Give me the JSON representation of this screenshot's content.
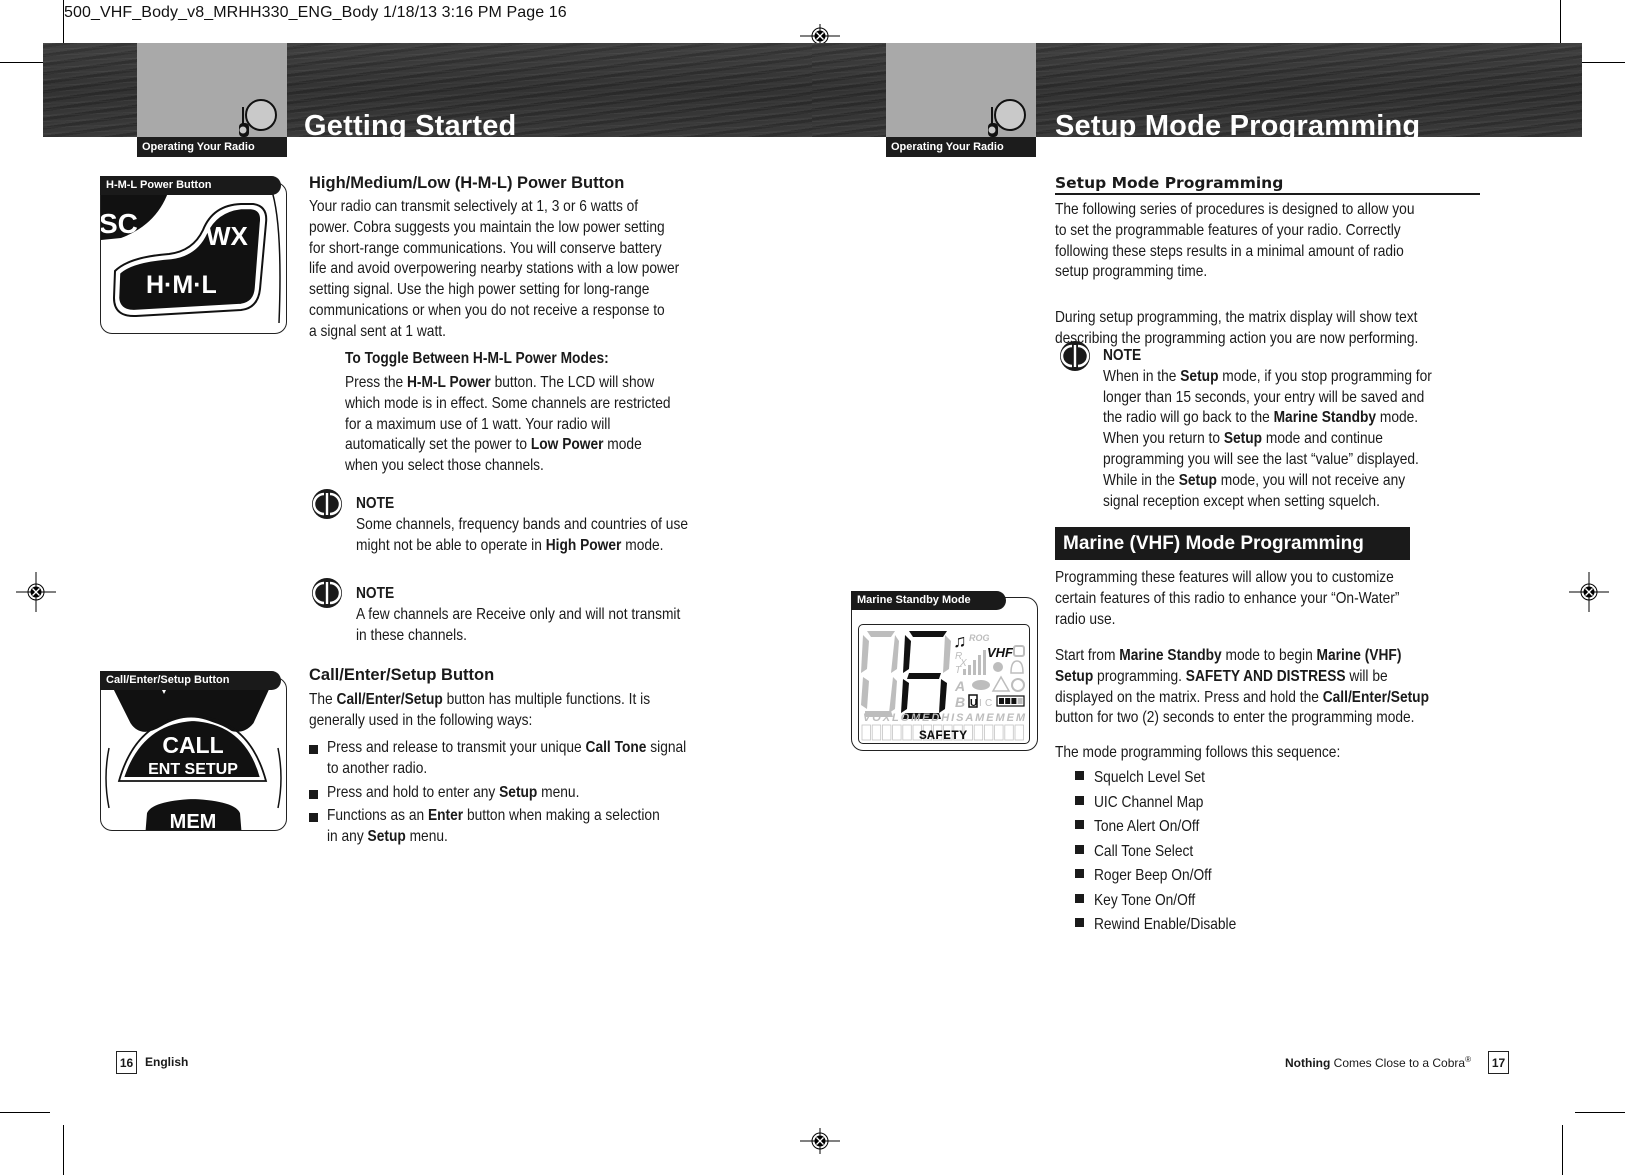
{
  "slug": "500_VHF_Body_v8_MRHH330_ENG_Body  1/18/13  3:16 PM  Page 16",
  "left_page": {
    "tab_label": "Operating Your Radio",
    "title": "Getting Started",
    "illustration_hml": {
      "tag": "H-M-L Power Button",
      "keys": [
        "SC",
        "WX",
        "H·M·L"
      ]
    },
    "hml_section": {
      "heading": "High/Medium/Low (H-M-L) Power Button",
      "body_lines": [
        "Your radio can transmit selectively at 1, 3 or 6 watts of",
        "power. Cobra suggests you maintain the low power setting",
        "for short-range communications. You will conserve battery",
        "life and avoid overpowering nearby stations with a low power",
        "setting signal. Use the high power setting for long-range",
        "communications or when you do not receive a response to",
        "a signal sent at 1 watt."
      ],
      "toggle_heading": "To Toggle Between H-M-L Power Modes:",
      "toggle_lines": [
        [
          {
            "t": "Press the "
          },
          {
            "t": "H-M-L Power",
            "b": true
          },
          {
            "t": " button. The LCD will show"
          }
        ],
        [
          {
            "t": "which mode is in effect. Some channels are restricted"
          }
        ],
        [
          {
            "t": "for a maximum use of 1 watt. Your radio will"
          }
        ],
        [
          {
            "t": "automatically set the power to "
          },
          {
            "t": "Low Power",
            "b": true
          },
          {
            "t": " mode"
          }
        ],
        [
          {
            "t": "when you select those channels."
          }
        ]
      ],
      "notes": [
        {
          "title": "NOTE",
          "lines": [
            [
              {
                "t": "Some channels, frequency bands and countries of use"
              }
            ],
            [
              {
                "t": "might not be able to operate in "
              },
              {
                "t": "High Power",
                "b": true
              },
              {
                "t": " mode."
              }
            ]
          ]
        },
        {
          "title": "NOTE",
          "lines": [
            [
              {
                "t": "A few channels are Receive only and will not transmit"
              }
            ],
            [
              {
                "t": "in these channels."
              }
            ]
          ]
        }
      ]
    },
    "illustration_call": {
      "tag": "Call/Enter/Setup Button",
      "keys": [
        "CALL",
        "ENT  SETUP",
        "MEM"
      ]
    },
    "call_section": {
      "heading": "Call/Enter/Setup Button",
      "intro_lines": [
        [
          {
            "t": "The "
          },
          {
            "t": "Call/Enter/Setup",
            "b": true
          },
          {
            "t": " button has multiple functions. It is"
          }
        ],
        [
          {
            "t": "generally used in the following ways:"
          }
        ]
      ],
      "bullets": [
        [
          [
            {
              "t": "Press and release to transmit your unique "
            },
            {
              "t": "Call Tone",
              "b": true
            },
            {
              "t": " signal"
            }
          ],
          [
            {
              "t": "to another radio."
            }
          ]
        ],
        [
          [
            {
              "t": "Press and hold to enter any "
            },
            {
              "t": "Setup",
              "b": true
            },
            {
              "t": " menu."
            }
          ]
        ],
        [
          [
            {
              "t": "Functions as an "
            },
            {
              "t": "Enter",
              "b": true
            },
            {
              "t": " button when making a selection"
            }
          ],
          [
            {
              "t": "in any "
            },
            {
              "t": "Setup",
              "b": true
            },
            {
              "t": " menu."
            }
          ]
        ]
      ]
    },
    "footer": {
      "page_number": "16",
      "label": "English"
    }
  },
  "right_page": {
    "tab_label": "Operating Your Radio",
    "title": "Setup Mode Programming",
    "setup_section": {
      "heading": "Setup Mode Programming",
      "para1_lines": [
        "The following series of procedures is designed to allow you",
        "to set the programmable features of your radio. Correctly",
        "following these steps results in a minimal amount of radio",
        "setup programming time."
      ],
      "para2_lines": [
        "During setup programming, the matrix display will show text",
        "describing the programming action you are now performing."
      ],
      "note": {
        "title": "NOTE",
        "lines": [
          [
            {
              "t": "When in the "
            },
            {
              "t": "Setup",
              "b": true
            },
            {
              "t": " mode, if you stop programming for"
            }
          ],
          [
            {
              "t": "longer than 15 seconds, your entry will be saved and"
            }
          ],
          [
            {
              "t": "the radio will go back to the "
            },
            {
              "t": "Marine Standby",
              "b": true
            },
            {
              "t": " mode."
            }
          ],
          [
            {
              "t": "When you return to "
            },
            {
              "t": "Setup",
              "b": true
            },
            {
              "t": " mode and continue"
            }
          ],
          [
            {
              "t": "programming you will see the last “value” displayed."
            }
          ],
          [
            {
              "t": "While in the "
            },
            {
              "t": "Setup",
              "b": true
            },
            {
              "t": " mode, you will not receive any"
            }
          ],
          [
            {
              "t": "signal reception except when setting squelch."
            }
          ]
        ]
      }
    },
    "marine_section": {
      "bar_title": "Marine (VHF) Mode Programming",
      "para1_lines": [
        "Programming these features will allow you to customize",
        "certain features of this radio to enhance your “On-Water”",
        "radio use."
      ],
      "para2_lines": [
        [
          {
            "t": "Start from "
          },
          {
            "t": "Marine Standby",
            "b": true
          },
          {
            "t": " mode to begin "
          },
          {
            "t": "Marine (VHF)",
            "b": true
          }
        ],
        [
          {
            "t": "Setup",
            "b": true
          },
          {
            "t": " programming. "
          },
          {
            "t": "SAFETY AND DISTRESS",
            "b": true
          },
          {
            "t": " will be"
          }
        ],
        [
          {
            "t": "displayed on the matrix. Press and hold the "
          },
          {
            "t": "Call/Enter/Setup",
            "b": true
          }
        ],
        [
          {
            "t": "button for two (2) seconds to enter the programming mode."
          }
        ]
      ],
      "sequence_intro": "The mode programming follows this sequence:",
      "sequence": [
        "Squelch Level Set",
        "UIC Channel Map",
        "Tone Alert On/Off",
        "Call Tone Select",
        "Roger Beep On/Off",
        "Key Tone On/Off",
        "Rewind Enable/Disable"
      ]
    },
    "illustration_lcd": {
      "tag": "Marine Standby Mode",
      "channel": "16",
      "indicators": {
        "rog": "ROG",
        "band": "VHF",
        "rx": "R",
        "x": "X",
        "tx": "T",
        "a": "A",
        "b": "B",
        "u": "U",
        "i": "I",
        "c": "C",
        "modes": "VOXLOMEDHISAMEMEM",
        "matrix_text": "SAFETY"
      },
      "battery_level": 0.75
    },
    "footer": {
      "label_bold": "Nothing",
      "label_rest": " Comes Close to a Cobra",
      "registered": "®",
      "page_number": "17"
    }
  }
}
